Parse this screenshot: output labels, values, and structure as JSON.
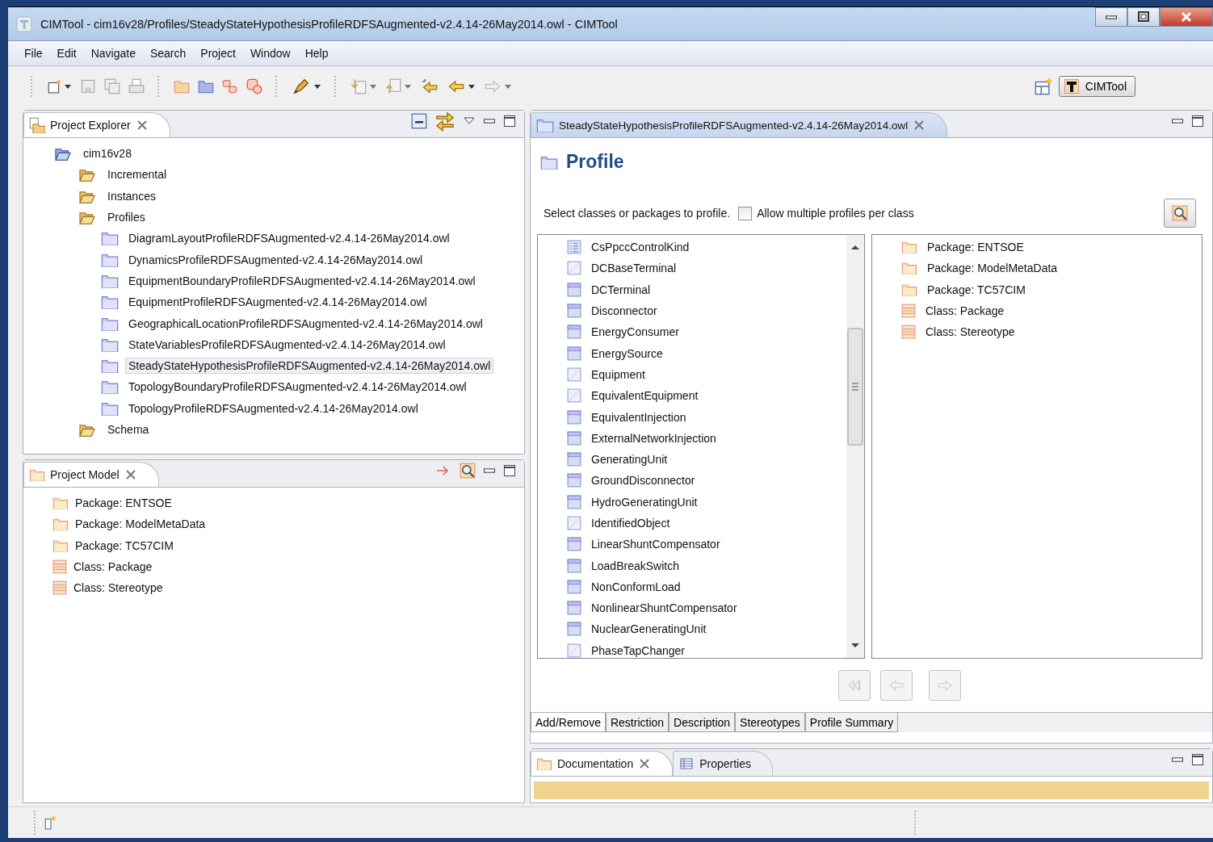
{
  "window": {
    "title": "CIMTool - cim16v28/Profiles/SteadyStateHypothesisProfileRDFSAugmented-v2.4.14-26May2014.owl - CIMTool"
  },
  "menu": [
    "File",
    "Edit",
    "Navigate",
    "Search",
    "Project",
    "Window",
    "Help"
  ],
  "perspective": {
    "label": "CIMTool",
    "selected": true
  },
  "project_explorer": {
    "title": "Project Explorer",
    "tree": [
      {
        "label": "cim16v28",
        "kind": "project",
        "selected": false,
        "children": [
          {
            "label": "Incremental",
            "kind": "folder",
            "selected": false
          },
          {
            "label": "Instances",
            "kind": "folder",
            "selected": false
          },
          {
            "label": "Profiles",
            "kind": "folder",
            "selected": false,
            "children": [
              {
                "label": "DiagramLayoutProfileRDFSAugmented-v2.4.14-26May2014.owl",
                "kind": "profile",
                "selected": false
              },
              {
                "label": "DynamicsProfileRDFSAugmented-v2.4.14-26May2014.owl",
                "kind": "profile",
                "selected": false
              },
              {
                "label": "EquipmentBoundaryProfileRDFSAugmented-v2.4.14-26May2014.owl",
                "kind": "profile",
                "selected": false
              },
              {
                "label": "EquipmentProfileRDFSAugmented-v2.4.14-26May2014.owl",
                "kind": "profile",
                "selected": false
              },
              {
                "label": "GeographicalLocationProfileRDFSAugmented-v2.4.14-26May2014.owl",
                "kind": "profile",
                "selected": false
              },
              {
                "label": "StateVariablesProfileRDFSAugmented-v2.4.14-26May2014.owl",
                "kind": "profile",
                "selected": false
              },
              {
                "label": "SteadyStateHypothesisProfileRDFSAugmented-v2.4.14-26May2014.owl",
                "kind": "profile",
                "selected": true
              },
              {
                "label": "TopologyBoundaryProfileRDFSAugmented-v2.4.14-26May2014.owl",
                "kind": "profile",
                "selected": false
              },
              {
                "label": "TopologyProfileRDFSAugmented-v2.4.14-26May2014.owl",
                "kind": "profile",
                "selected": false
              }
            ]
          },
          {
            "label": "Schema",
            "kind": "folder",
            "selected": false
          }
        ]
      }
    ]
  },
  "project_model": {
    "title": "Project Model",
    "items": [
      {
        "label": "Package: ENTSOE",
        "kind": "package"
      },
      {
        "label": "Package: ModelMetaData",
        "kind": "package"
      },
      {
        "label": "Package: TC57CIM",
        "kind": "package"
      },
      {
        "label": "Class: Package",
        "kind": "class"
      },
      {
        "label": "Class: Stereotype",
        "kind": "class"
      }
    ]
  },
  "editor": {
    "tab": "SteadyStateHypothesisProfileRDFSAugmented-v2.4.14-26May2014.owl",
    "heading": "Profile",
    "instruction": "Select classes or packages to profile.",
    "allow_multiple": {
      "label": "Allow multiple profiles per class",
      "checked": false
    },
    "classes": [
      {
        "label": "CsPpccControlKind",
        "kind": "enum"
      },
      {
        "label": "DCBaseTerminal",
        "kind": "abstract"
      },
      {
        "label": "DCTerminal",
        "kind": "class"
      },
      {
        "label": "Disconnector",
        "kind": "class"
      },
      {
        "label": "EnergyConsumer",
        "kind": "class"
      },
      {
        "label": "EnergySource",
        "kind": "class"
      },
      {
        "label": "Equipment",
        "kind": "abstract"
      },
      {
        "label": "EquivalentEquipment",
        "kind": "abstract"
      },
      {
        "label": "EquivalentInjection",
        "kind": "class"
      },
      {
        "label": "ExternalNetworkInjection",
        "kind": "class"
      },
      {
        "label": "GeneratingUnit",
        "kind": "class"
      },
      {
        "label": "GroundDisconnector",
        "kind": "class"
      },
      {
        "label": "HydroGeneratingUnit",
        "kind": "class"
      },
      {
        "label": "IdentifiedObject",
        "kind": "abstract"
      },
      {
        "label": "LinearShuntCompensator",
        "kind": "class"
      },
      {
        "label": "LoadBreakSwitch",
        "kind": "class"
      },
      {
        "label": "NonConformLoad",
        "kind": "class"
      },
      {
        "label": "NonlinearShuntCompensator",
        "kind": "class"
      },
      {
        "label": "NuclearGeneratingUnit",
        "kind": "class"
      },
      {
        "label": "PhaseTapChanger",
        "kind": "abstract"
      }
    ],
    "profiled": [
      {
        "label": "Package: ENTSOE",
        "kind": "package"
      },
      {
        "label": "Package: ModelMetaData",
        "kind": "package"
      },
      {
        "label": "Package: TC57CIM",
        "kind": "package"
      },
      {
        "label": "Class: Package",
        "kind": "class"
      },
      {
        "label": "Class: Stereotype",
        "kind": "class"
      }
    ],
    "pages": [
      {
        "label": "Add/Remove",
        "selected": true
      },
      {
        "label": "Restriction",
        "selected": false
      },
      {
        "label": "Description",
        "selected": false
      },
      {
        "label": "Stereotypes",
        "selected": false
      },
      {
        "label": "Profile Summary",
        "selected": false
      }
    ]
  },
  "bottom_panel": {
    "tabs": [
      {
        "label": "Documentation",
        "kind": "documentation",
        "selected": true
      },
      {
        "label": "Properties",
        "kind": "properties",
        "selected": false
      }
    ]
  }
}
